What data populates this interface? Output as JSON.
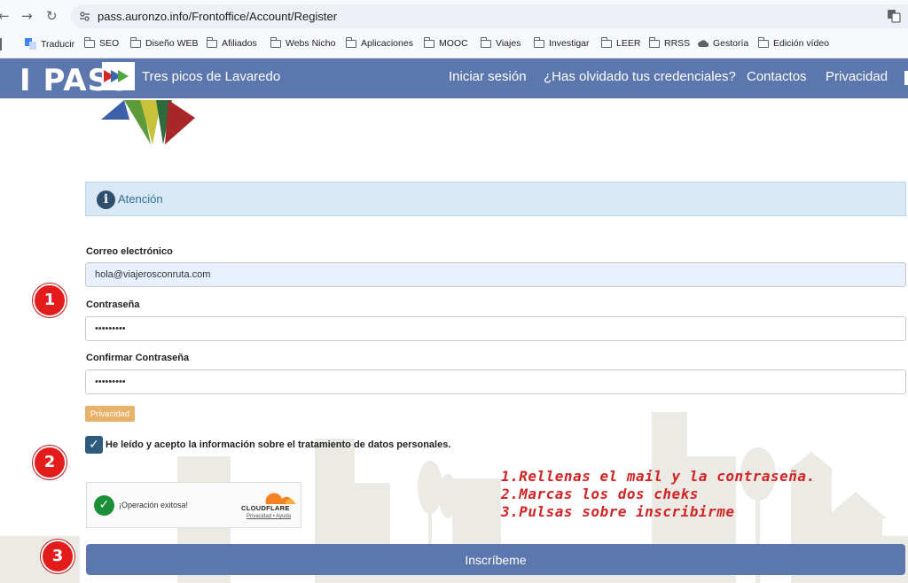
{
  "browser": {
    "url": "pass.auronzo.info/Frontoffice/Account/Register",
    "bookmarks": [
      "Traducir",
      "SEO",
      "Diseño WEB",
      "Afiliados",
      "Webs Nicho",
      "Aplicaciones",
      "MOOC",
      "Viajes",
      "Investigar",
      "LEER",
      "RRSS",
      "Gestoría",
      "Edición vídeo"
    ]
  },
  "header": {
    "logo": "I PASS",
    "title": "Tres picos de Lavaredo",
    "nav": [
      "Iniciar sesión",
      "¿Has olvidado tus credenciales?",
      "Contactos",
      "Privacidad"
    ]
  },
  "alert": {
    "icon": "info-icon",
    "text": "Atención"
  },
  "form": {
    "email_label": "Correo electrónico",
    "email_value": "hola@viajerosconruta.com",
    "password_label": "Contraseña",
    "password_value": "•••••••••",
    "confirm_label": "Confirmar Contraseña",
    "confirm_value": "•••••••••",
    "privacy_button": "Privacidad",
    "consent_text": "He leído y acepto la información sobre el tratamiento de datos personales.",
    "submit_label": "Inscríbeme"
  },
  "captcha": {
    "status": "¡Operación exitosa!",
    "brand": "CLOUDFLARE",
    "links": "Privacidad • Ayuda"
  },
  "annotations": {
    "badges": [
      "1",
      "2",
      "3"
    ],
    "instructions": [
      "1.Rellenas el mail y la contraseña.",
      "2.Marcas los dos cheks",
      "3.Pulsas sobre inscribirme"
    ]
  },
  "colors": {
    "header_bg": "#5c77ad",
    "badge_red": "#e31b1b",
    "annotation_red": "#d12424",
    "privacy_btn": "#e9b26a"
  }
}
